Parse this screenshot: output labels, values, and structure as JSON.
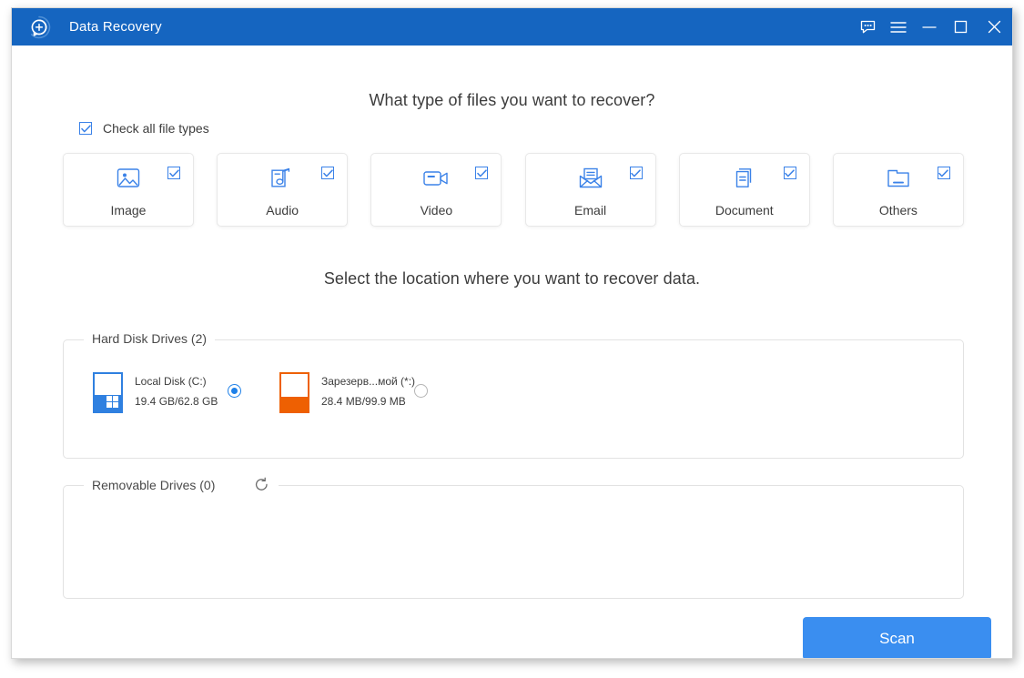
{
  "window": {
    "title": "Data Recovery",
    "logo_icon": "search-bubble-logo-icon",
    "titlebar_color": "#1565c0",
    "controls": [
      {
        "name": "feedback-icon",
        "label": "Feedback"
      },
      {
        "name": "menu-icon",
        "label": "Menu"
      },
      {
        "name": "minimize-icon",
        "label": "Minimize"
      },
      {
        "name": "maximize-icon",
        "label": "Maximize"
      },
      {
        "name": "close-icon",
        "label": "Close"
      }
    ]
  },
  "headings": {
    "file_types": "What type of files you want to recover?",
    "location": "Select the location where you want to recover data."
  },
  "check_all": {
    "label": "Check all file types",
    "checked": true
  },
  "file_types": [
    {
      "label": "Image",
      "icon": "image-icon",
      "checked": true
    },
    {
      "label": "Audio",
      "icon": "audio-icon",
      "checked": true
    },
    {
      "label": "Video",
      "icon": "video-icon",
      "checked": true
    },
    {
      "label": "Email",
      "icon": "email-icon",
      "checked": true
    },
    {
      "label": "Document",
      "icon": "document-icon",
      "checked": true
    },
    {
      "label": "Others",
      "icon": "folder-icon",
      "checked": true
    }
  ],
  "hard_disk_drives": {
    "title": "Hard Disk Drives (2)",
    "drives": [
      {
        "name": "Local Disk (C:)",
        "size": "19.4 GB/62.8 GB",
        "selected": true,
        "icon": "windows-disk-icon",
        "accent": "#2f80e0"
      },
      {
        "name": "Зарезерв...мой (*:)",
        "size": "28.4 MB/99.9 MB",
        "selected": false,
        "icon": "disk-icon",
        "accent": "#ee6002"
      }
    ]
  },
  "removable_drives": {
    "title": "Removable Drives (0)",
    "refresh_icon": "refresh-icon",
    "drives": []
  },
  "actions": {
    "scan_label": "Scan",
    "scan_color": "#3a8ef0"
  }
}
